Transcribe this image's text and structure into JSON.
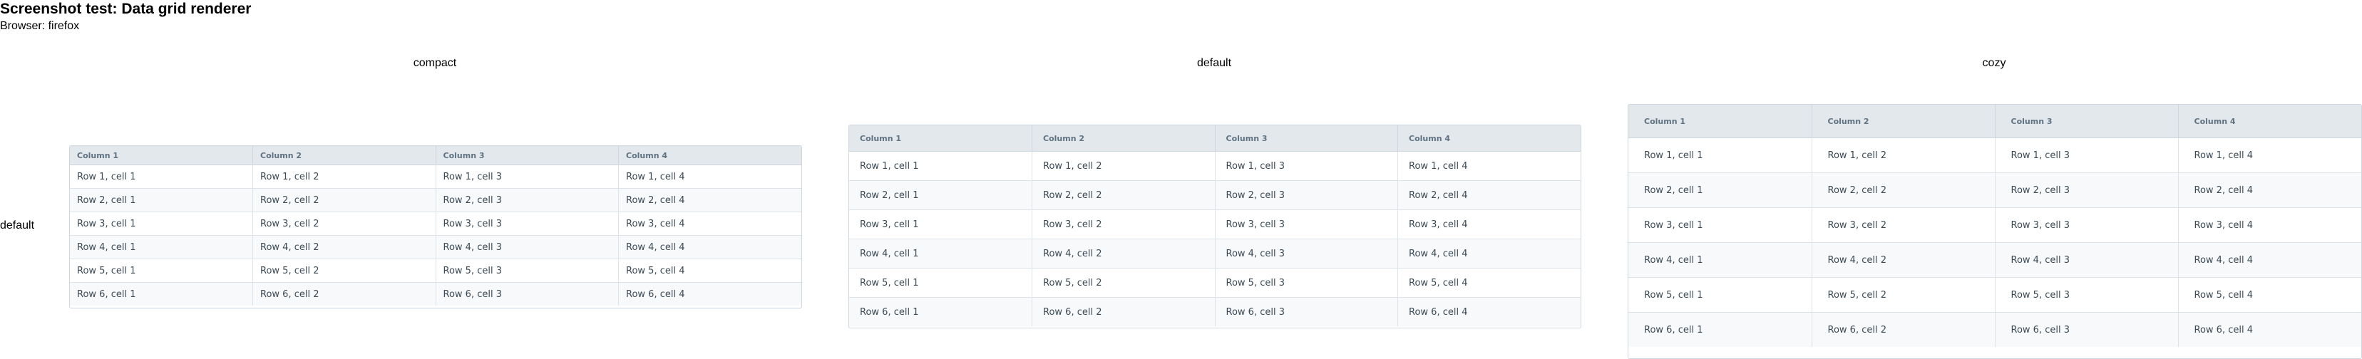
{
  "title": "Screenshot test: Data grid renderer",
  "browser_label": "Browser: firefox",
  "density_headers": {
    "compact": "compact",
    "default": "default",
    "cozy": "cozy"
  },
  "row_header": "default",
  "columns": [
    "Column 1",
    "Column 2",
    "Column 3",
    "Column 4"
  ],
  "rows": [
    [
      "Row 1, cell 1",
      "Row 1, cell 2",
      "Row 1, cell 3",
      "Row 1, cell 4"
    ],
    [
      "Row 2, cell 1",
      "Row 2, cell 2",
      "Row 2, cell 3",
      "Row 2, cell 4"
    ],
    [
      "Row 3, cell 1",
      "Row 3, cell 2",
      "Row 3, cell 3",
      "Row 3, cell 4"
    ],
    [
      "Row 4, cell 1",
      "Row 4, cell 2",
      "Row 4, cell 3",
      "Row 4, cell 4"
    ],
    [
      "Row 5, cell 1",
      "Row 5, cell 2",
      "Row 5, cell 3",
      "Row 5, cell 4"
    ],
    [
      "Row 6, cell 1",
      "Row 6, cell 2",
      "Row 6, cell 3",
      "Row 6, cell 4"
    ]
  ],
  "colors": {
    "header_background": "#e3e8ed",
    "header_text": "#5f7281",
    "cell_text": "#3b4a55",
    "border": "#cfd6dd",
    "stripe": "#f7f9fb"
  }
}
